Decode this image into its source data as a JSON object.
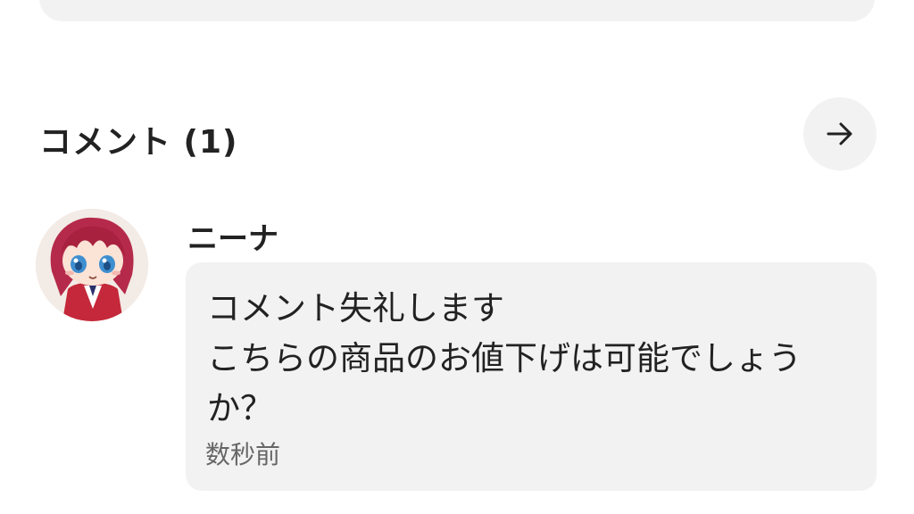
{
  "section": {
    "title": "コメント (1)",
    "arrow_icon": "arrow-right-icon"
  },
  "comment": {
    "username": "ニーナ",
    "avatar_icon": "avatar-character-icon",
    "text": "コメント失礼します\nこちらの商品のお値下げは可能でしょう\nか？",
    "timestamp": "数秒前"
  },
  "colors": {
    "card_background": "#f2f2f2",
    "text_primary": "#222222",
    "text_secondary": "#666666"
  }
}
